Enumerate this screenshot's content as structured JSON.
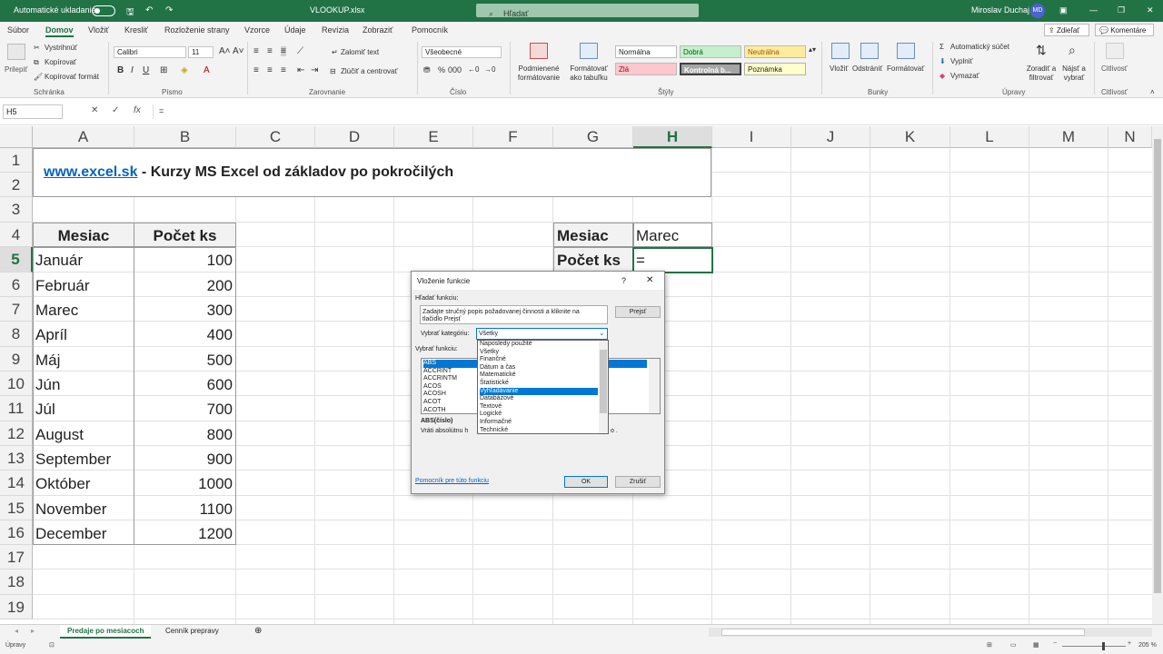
{
  "titlebar": {
    "autosave": "Automatické ukladanie",
    "filename": "VLOOKUP.xlsx",
    "search": "Hľadať",
    "user": "Miroslav Duchaj",
    "initials": "MD"
  },
  "tabs": [
    "Súbor",
    "Domov",
    "Vložiť",
    "Kresliť",
    "Rozloženie strany",
    "Vzorce",
    "Údaje",
    "Revízia",
    "Zobraziť",
    "Pomocník"
  ],
  "share": "Zdieľať",
  "comments": "Komentáre",
  "ribbon": {
    "paste": "Prilepiť",
    "cut": "Vystrihnúť",
    "copy": "Kopírovať",
    "format_painter": "Kopírovať formát",
    "font": "Calibri",
    "size": "11",
    "wrap": "Zalomiť text",
    "merge": "Zlúčiť a centrovať",
    "number_format": "Všeobecné",
    "cond_format": "Podmienené formátovanie",
    "format_table": "Formátovať ako tabuľku",
    "styles": [
      "Normálna",
      "Dobrá",
      "Neutrálna",
      "Zlá",
      "Kontrolná b...",
      "Poznámka"
    ],
    "insert": "Vložiť",
    "delete": "Odstrániť",
    "format": "Formátovať",
    "autosum": "Automatický súčet",
    "fill": "Vyplniť",
    "clear": "Vymazať",
    "sort": "Zoradiť a filtrovať",
    "find": "Nájsť a vybrať",
    "sensitivity": "Citlivosť",
    "groups": [
      "Schránka",
      "Písmo",
      "Zarovnanie",
      "Číslo",
      "Štýly",
      "Bunky",
      "Úpravy",
      "Citlivosť"
    ]
  },
  "formula_bar": {
    "name_box": "H5",
    "formula": "="
  },
  "columns": [
    "A",
    "B",
    "C",
    "D",
    "E",
    "F",
    "G",
    "H",
    "I",
    "J",
    "K",
    "L",
    "M",
    "N"
  ],
  "rows": [
    "1",
    "2",
    "3",
    "4",
    "5",
    "6",
    "7",
    "8",
    "9",
    "10",
    "11",
    "12",
    "13",
    "14",
    "15",
    "16",
    "17",
    "18",
    "19"
  ],
  "sheet": {
    "link": "www.excel.sk",
    "title_rest": " - Kurzy MS Excel od základov po pokročilých",
    "table_headers": [
      "Mesiac",
      "Počet ks"
    ],
    "table": [
      [
        "Január",
        "100"
      ],
      [
        "Február",
        "200"
      ],
      [
        "Marec",
        "300"
      ],
      [
        "Apríl",
        "400"
      ],
      [
        "Máj",
        "500"
      ],
      [
        "Jún",
        "600"
      ],
      [
        "Júl",
        "700"
      ],
      [
        "August",
        "800"
      ],
      [
        "September",
        "900"
      ],
      [
        "Október",
        "1000"
      ],
      [
        "November",
        "1100"
      ],
      [
        "December",
        "1200"
      ]
    ],
    "lookup_labels": [
      "Mesiac",
      "Počet ks"
    ],
    "lookup_month": "Marec",
    "lookup_formula": "="
  },
  "dialog": {
    "title": "Vloženie funkcie",
    "help": "?",
    "close": "✕",
    "search_label": "Hľadať funkciu:",
    "search_text_1": "Zadajte stručný popis požadovanej činnosti a kliknite na",
    "search_text_2": "tlačidlo Prejsť",
    "go": "Prejsť",
    "category_label": "Vybrať kategóriu:",
    "category_value": "Všetky",
    "select_label": "Vybrať funkciu:",
    "functions": [
      "ABS",
      "ACCRINT",
      "ACCRINTM",
      "ACOS",
      "ACOSH",
      "ACOT",
      "ACOTH"
    ],
    "categories": [
      "Naposledy použité",
      "Všetky",
      "Finančné",
      "Dátum a čas",
      "Matematické",
      "Štatistické",
      "Vyhľadávanie",
      "Databázové",
      "Textové",
      "Logické",
      "Informačné",
      "Technické"
    ],
    "signature": "ABS(číslo)",
    "description": "Vráti absolútnu h",
    "description_tail": "o .",
    "help_link": "Pomocník pre túto funkciu",
    "ok": "OK",
    "cancel": "Zrušiť"
  },
  "sheet_tabs": [
    "Predaje po mesiacoch",
    "Cenník prepravy"
  ],
  "status": {
    "mode": "Úpravy",
    "zoom": "205 %"
  }
}
